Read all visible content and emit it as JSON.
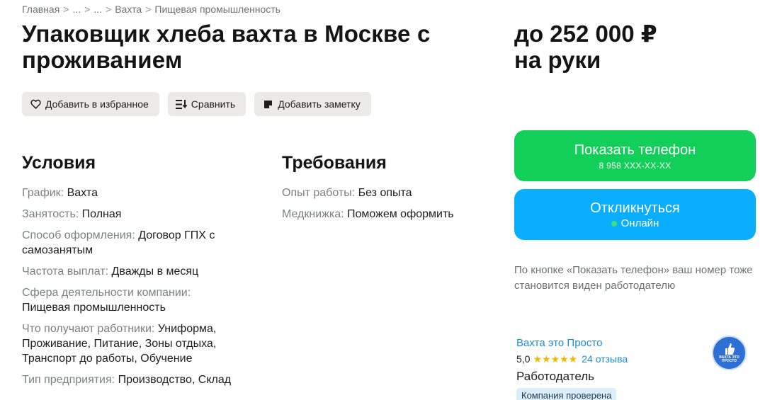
{
  "breadcrumb": [
    "Главная",
    "...",
    "...",
    "Вахта",
    "Пищевая промышленность"
  ],
  "breadcrumb_separator": ">",
  "title": "Упаковщик хлеба вахта в Москве с проживанием",
  "salary": {
    "line1": "до 252 000 ₽",
    "line2": "на руки"
  },
  "actions": {
    "favorite": "Добавить в избранное",
    "compare": "Сравнить",
    "note": "Добавить заметку"
  },
  "conditions": {
    "title": "Условия",
    "items": [
      {
        "label": "График:",
        "value": "Вахта"
      },
      {
        "label": "Занятость:",
        "value": "Полная"
      },
      {
        "label": "Способ оформления:",
        "value": "Договор ГПХ с самозанятым"
      },
      {
        "label": "Частота выплат:",
        "value": "Дважды в месяц"
      },
      {
        "label": "Сфера деятельности компании:",
        "value": "Пищевая промышленность"
      },
      {
        "label": "Что получают работники:",
        "value": "Униформа, Проживание, Питание, Зоны отдыха, Транспорт до работы, Обучение"
      },
      {
        "label": "Тип предприятия:",
        "value": "Производство, Склад"
      }
    ]
  },
  "requirements": {
    "title": "Требования",
    "items": [
      {
        "label": "Опыт работы:",
        "value": "Без опыта"
      },
      {
        "label": "Медкнижка:",
        "value": "Поможем оформить"
      }
    ]
  },
  "phone_button": {
    "label": "Показать телефон",
    "number": "8 958 XXX-XX-XX",
    "color": "#12cf5a"
  },
  "respond_button": {
    "label": "Откликнуться",
    "status": "Онлайн",
    "color": "#0aaeff"
  },
  "hint": "По кнопке «Показать телефон» ваш номер тоже становится виден работодателю",
  "employer": {
    "name": "Вахта это Просто",
    "rating": "5,0",
    "stars": "★★★★★",
    "reviews": "24 отзыва",
    "role": "Работодатель",
    "badge": "Компания проверена",
    "logo_text": "ВАХТА ЭТО ПРОСТО"
  }
}
